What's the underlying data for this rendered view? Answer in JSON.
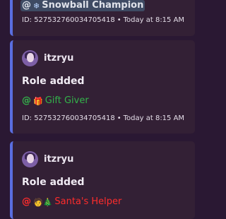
{
  "messages": [
    {
      "role": {
        "at": "@",
        "glyph": "❄",
        "name": "Snowball Champion",
        "color": "#dfe2ea",
        "highlight": "#3e4a63"
      },
      "footer": {
        "id": "ID: 527532760034705418",
        "separator": "•",
        "time": "Today at 8:15 AM"
      }
    },
    {
      "author": "itzryu",
      "title": "Role added",
      "role": {
        "at": "@",
        "glyph": "🎁",
        "name": "Gift Giver",
        "color": "#33b34a"
      },
      "footer": {
        "id": "ID: 527532760034705418",
        "separator": "•",
        "time": "Today at 8:15 AM"
      }
    },
    {
      "author": "itzryu",
      "title": "Role added",
      "role": {
        "at": "@",
        "glyph": "🧑🎄",
        "name": "Santa's Helper",
        "color": "#ff2c2c"
      }
    }
  ],
  "accent": "#5a6ee0",
  "icons": {
    "avatar": "user-avatar-icon",
    "snowflake": "snowflake-icon",
    "gift": "gift-icon",
    "santa-helper": "person-tree-icon"
  }
}
